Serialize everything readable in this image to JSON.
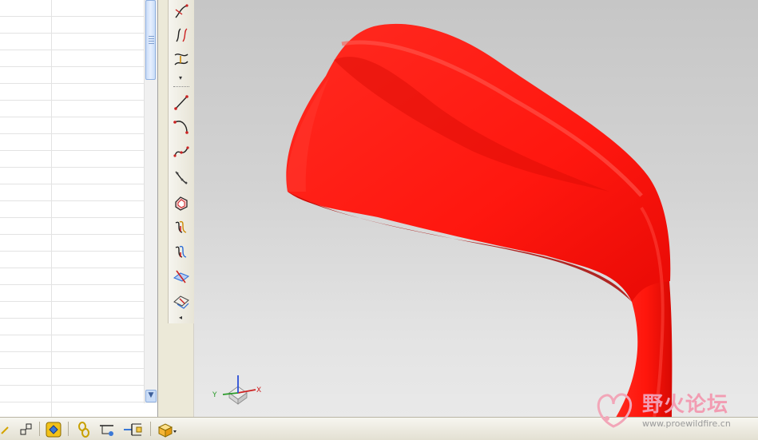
{
  "table": {
    "rows": 25
  },
  "vertical_toolbar": {
    "icons": [
      "curve-trim-icon",
      "curve-split-icon",
      "curve-blend-icon",
      "line-icon",
      "arc-icon",
      "spline-icon",
      "curve-through-points-icon",
      "boundary-curve-icon",
      "offset-curve-icon",
      "project-curve-icon",
      "plane-intersect-icon",
      "section-curve-icon"
    ]
  },
  "bottom_toolbar": {
    "icons": [
      "dimension-icon",
      "constraint-icon",
      "material-icon",
      "chain-link-icon",
      "sketch-icon",
      "flow-icon",
      "view-style-icon"
    ]
  },
  "viewport": {
    "model_color": "#ff1a12",
    "background_top": "#c6c6c6",
    "background_bottom": "#e9e9e9"
  },
  "triad": {
    "x_label": "X",
    "y_label": "Y"
  },
  "watermark": {
    "title": "野火论坛",
    "url": "www.proewildfire.cn"
  }
}
